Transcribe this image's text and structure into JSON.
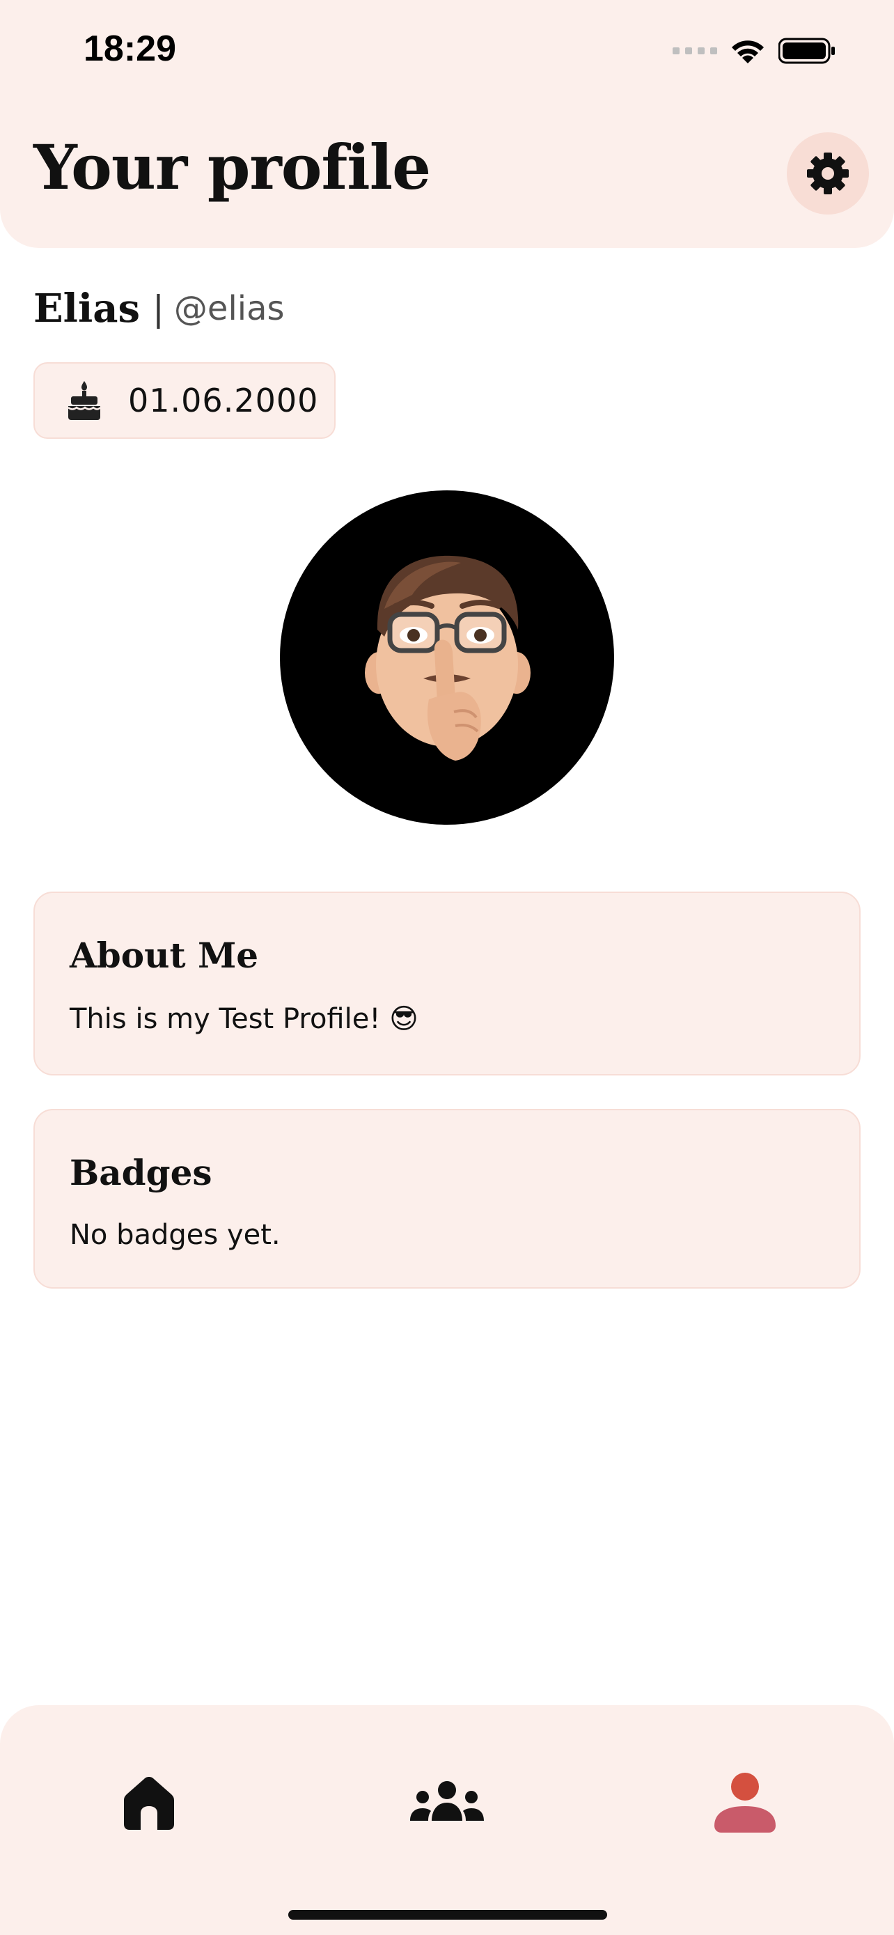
{
  "status_bar": {
    "time": "18:29",
    "icons": [
      "signal-icon",
      "wifi-icon",
      "battery-icon"
    ]
  },
  "header": {
    "title": "Your profile",
    "settings_icon": "gear-icon"
  },
  "profile": {
    "name": "Elias",
    "separator": "|",
    "handle": "@elias",
    "birthday": "01.06.2000",
    "birthday_icon": "cake-icon",
    "avatar": "memoji-avatar"
  },
  "about": {
    "title": "About Me",
    "text": "This is my Test Profile! 😎"
  },
  "badges": {
    "title": "Badges",
    "text": "No badges yet."
  },
  "nav": {
    "items": [
      {
        "name": "home",
        "icon": "home-icon",
        "active": false
      },
      {
        "name": "friends",
        "icon": "group-icon",
        "active": false
      },
      {
        "name": "profile",
        "icon": "person-icon",
        "active": true
      }
    ]
  },
  "colors": {
    "surface": "#fcefeb",
    "border": "#f7ddd6",
    "settings_bg": "#f8ddd5",
    "active_head": "#d4503f",
    "active_body": "#c95b6a",
    "text": "#111111"
  }
}
